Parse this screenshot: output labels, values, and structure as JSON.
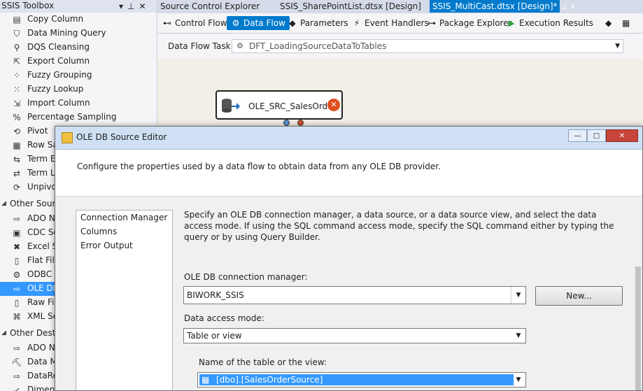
{
  "toolbox": {
    "title": "SSIS Toolbox",
    "controls": [
      "▾",
      "⊥",
      "✕"
    ],
    "items_top": [
      {
        "label": "Copy Column",
        "icon": "copy-column-icon",
        "glyph": "▤"
      },
      {
        "label": "Data Mining Query",
        "icon": "data-mining-query-icon",
        "glyph": "⛉"
      },
      {
        "label": "DQS Cleansing",
        "icon": "dqs-cleansing-icon",
        "glyph": "⚲"
      },
      {
        "label": "Export Column",
        "icon": "export-column-icon",
        "glyph": "⇱"
      },
      {
        "label": "Fuzzy Grouping",
        "icon": "fuzzy-grouping-icon",
        "glyph": "⁘"
      },
      {
        "label": "Fuzzy Lookup",
        "icon": "fuzzy-lookup-icon",
        "glyph": "⁙"
      },
      {
        "label": "Import Column",
        "icon": "import-column-icon",
        "glyph": "⇲"
      },
      {
        "label": "Percentage Sampling",
        "icon": "percentage-sampling-icon",
        "glyph": "%"
      },
      {
        "label": "Pivot",
        "icon": "pivot-icon",
        "glyph": "⟲"
      },
      {
        "label": "Row Sa",
        "icon": "row-sampling-icon",
        "glyph": "▦"
      },
      {
        "label": "Term Ex",
        "icon": "term-extraction-icon",
        "glyph": "⇆"
      },
      {
        "label": "Term Lo",
        "icon": "term-lookup-icon",
        "glyph": "⇄"
      },
      {
        "label": "Unpivo",
        "icon": "unpivot-icon",
        "glyph": "⟳"
      }
    ],
    "group_sources": "Other Sourc",
    "items_sources": [
      {
        "label": "ADO NI",
        "icon": "ado-net-source-icon",
        "glyph": "⇨"
      },
      {
        "label": "CDC So",
        "icon": "cdc-source-icon",
        "glyph": "▣"
      },
      {
        "label": "Excel So",
        "icon": "excel-source-icon",
        "glyph": "✖"
      },
      {
        "label": "Flat File",
        "icon": "flat-file-source-icon",
        "glyph": "▯"
      },
      {
        "label": "ODBC S",
        "icon": "odbc-source-icon",
        "glyph": "⚙"
      },
      {
        "label": "OLE DB",
        "icon": "ole-db-source-icon",
        "glyph": "⇨",
        "selected": true
      },
      {
        "label": "Raw File",
        "icon": "raw-file-source-icon",
        "glyph": "▯"
      },
      {
        "label": "XML So",
        "icon": "xml-source-icon",
        "glyph": "⌘"
      }
    ],
    "group_destinations": "Other Destin",
    "items_destinations": [
      {
        "label": "ADO NI",
        "icon": "ado-net-destination-icon",
        "glyph": "⇨"
      },
      {
        "label": "Data Mi",
        "icon": "data-mining-model-training-icon",
        "glyph": "⛏"
      },
      {
        "label": "DataRe",
        "icon": "datareader-destination-icon",
        "glyph": "⇨"
      },
      {
        "label": "Dimens",
        "icon": "dimension-processing-icon",
        "glyph": "↙"
      }
    ]
  },
  "tabs": [
    {
      "label": "Source Control Explorer",
      "active": false
    },
    {
      "label": "SSIS_SharePointList.dtsx [Design]",
      "active": false
    },
    {
      "label": "SSIS_MultiCast.dtsx [Design]*",
      "active": true
    }
  ],
  "tab_active_icons": "⊥ ✕",
  "designer_toolbar": [
    {
      "label": "Control Flow",
      "icon": "control-flow-icon",
      "glyph": "⊷",
      "active": false
    },
    {
      "label": "Data Flow",
      "icon": "data-flow-icon",
      "glyph": "⚙",
      "active": true
    },
    {
      "label": "Parameters",
      "icon": "parameters-icon",
      "glyph": "◆",
      "active": false
    },
    {
      "label": "Event Handlers",
      "icon": "event-handlers-icon",
      "glyph": "⚡",
      "active": false
    },
    {
      "label": "Package Explorer",
      "icon": "package-explorer-icon",
      "glyph": "⊶",
      "active": false
    },
    {
      "label": "Execution Results",
      "icon": "execution-results-icon",
      "glyph": "▶",
      "active": false
    }
  ],
  "toolbar_right_icons": [
    "◆",
    "▦"
  ],
  "task": {
    "label": "Data Flow Task:",
    "value": "DFT_LoadingSourceDataToTables"
  },
  "node": {
    "label": "OLE_SRC_SalesOrder",
    "error_glyph": "✕"
  },
  "dialog": {
    "title": "OLE DB Source Editor",
    "window_buttons": [
      "—",
      "□",
      "✕"
    ],
    "header": "Configure the properties used by a data flow to obtain data from any OLE DB provider.",
    "nav": [
      "Connection Manager",
      "Columns",
      "Error Output"
    ],
    "description": "Specify an OLE DB connection manager, a data source, or a data source view, and select the data access mode. If using the SQL command access mode, specify the SQL command either by typing the query or by using Query Builder.",
    "conn_label": "OLE DB connection manager:",
    "conn_value": "BIWORK_SSIS",
    "new_button": "New...",
    "mode_label": "Data access mode:",
    "mode_value": "Table or view",
    "table_label": "Name of the table or the view:",
    "table_value": "[dbo].[SalesOrderSource]"
  },
  "colors": {
    "accent": "#007acc",
    "selection": "#3399ff",
    "error": "#e04f1d"
  }
}
